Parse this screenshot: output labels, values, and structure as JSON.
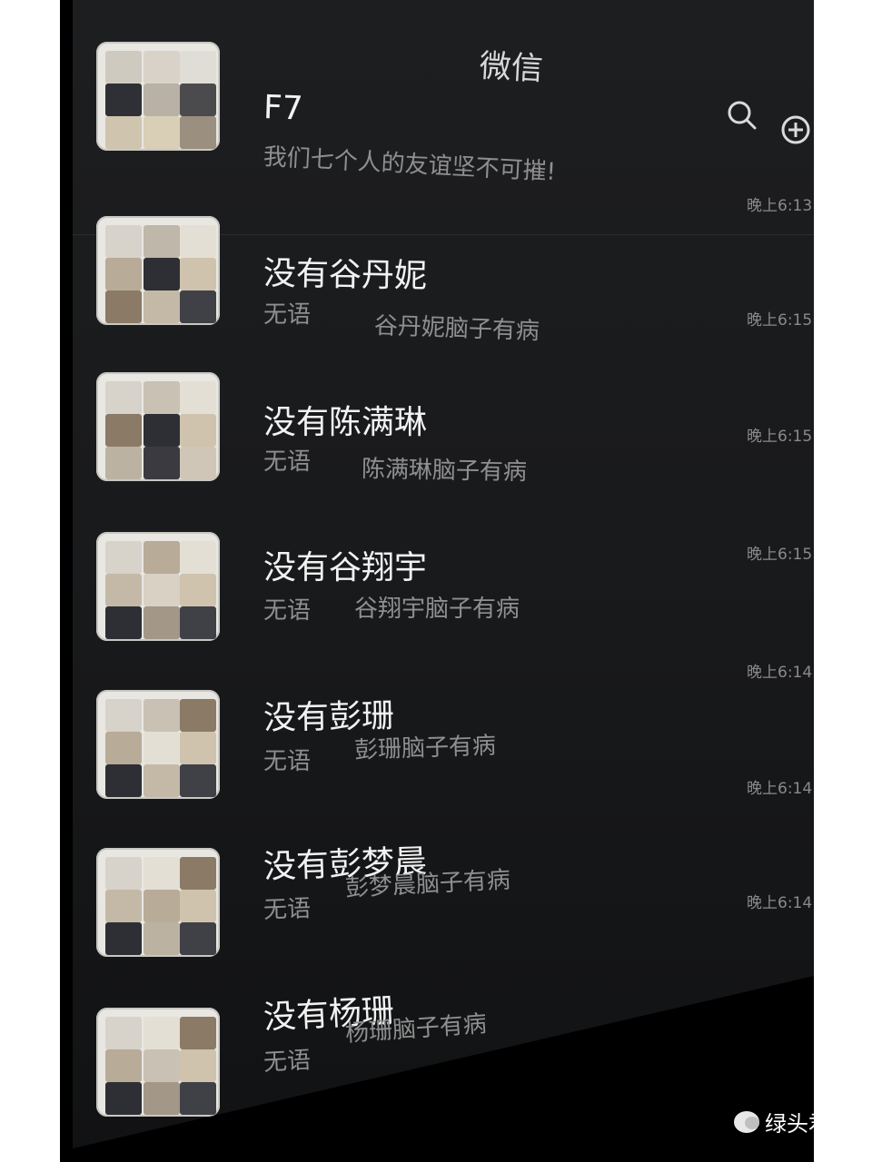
{
  "header": {
    "title": "微信",
    "search_icon": "search-icon",
    "add_icon": "plus-circle-icon"
  },
  "chats": [
    {
      "name": "F7",
      "preview": "我们七个人的友谊坚不可摧!",
      "time": "晚上6:13"
    },
    {
      "name": "没有谷丹妮",
      "preview_sender": "无语",
      "preview": "谷丹妮脑子有病",
      "time": "晚上6:15"
    },
    {
      "name": "没有陈满琳",
      "preview_sender": "无语",
      "preview": "陈满琳脑子有病",
      "time": "晚上6:15"
    },
    {
      "name": "没有谷翔宇",
      "preview_sender": "无语",
      "preview": "谷翔宇脑子有病",
      "time": "晚上6:15"
    },
    {
      "name": "没有彭珊",
      "preview_sender": "无语",
      "preview": "彭珊脑子有病",
      "time": "晚上6:14"
    },
    {
      "name": "没有彭梦晨",
      "preview_sender": "无语",
      "preview": "彭梦晨脑子有病",
      "time": "晚上6:14"
    },
    {
      "name": "没有杨珊",
      "preview_sender": "无语",
      "preview": "杨珊脑子有病",
      "time": "晚上6:14"
    }
  ],
  "watermark": {
    "text": "绿头君"
  },
  "colors": {
    "background": "#1b1c1e",
    "text_primary": "#f2f2f2",
    "text_secondary": "#8f8f8f"
  }
}
